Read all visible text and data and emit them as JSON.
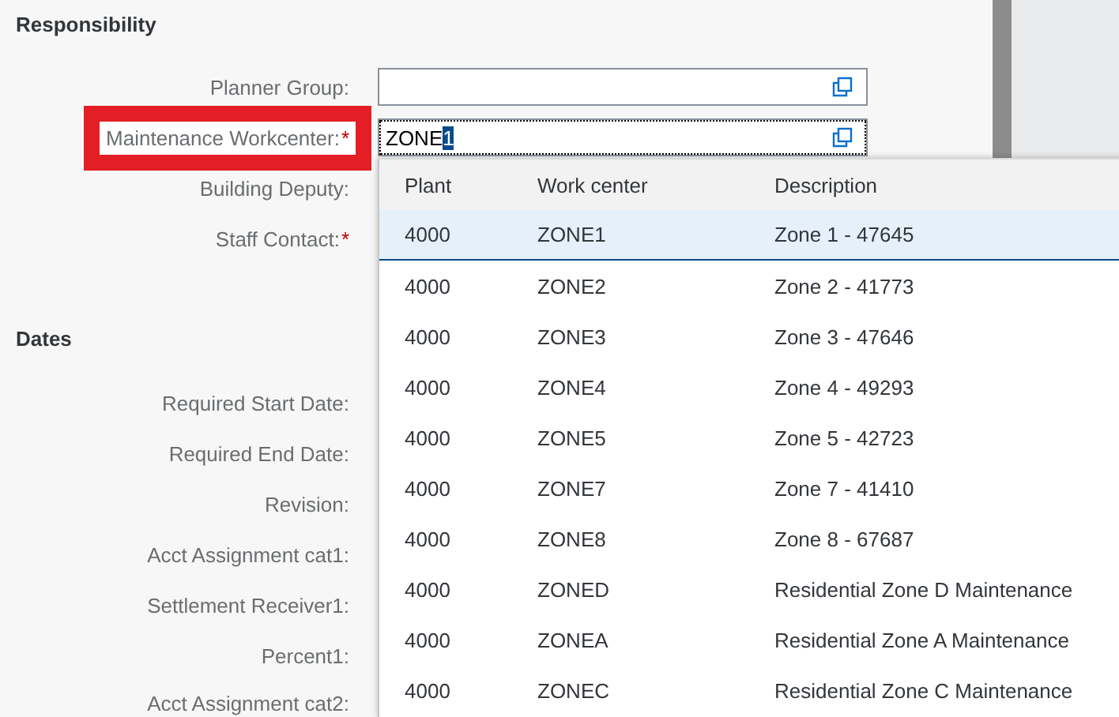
{
  "required_mark": "*",
  "sections": [
    {
      "title": "Responsibility",
      "fields": [
        {
          "label": "Planner Group:",
          "required": false,
          "kind": "valuehelp",
          "highlighted": false
        },
        {
          "label": "Maintenance Workcenter:",
          "required": true,
          "kind": "valuehelp",
          "value": "ZONE",
          "selected_text": "1",
          "highlighted": true
        },
        {
          "label": "Building Deputy:",
          "required": false,
          "kind": "hidden"
        },
        {
          "label": "Staff Contact:",
          "required": true,
          "kind": "hidden"
        }
      ]
    },
    {
      "title": "Dates",
      "fields": [
        {
          "label": "Required Start Date:",
          "required": false,
          "kind": "hidden"
        },
        {
          "label": "Required End Date:",
          "required": false,
          "kind": "hidden"
        },
        {
          "label": "Revision:",
          "required": false,
          "kind": "hidden"
        },
        {
          "label": "Acct Assignment cat1:",
          "required": false,
          "kind": "hidden"
        },
        {
          "label": "Settlement Receiver1:",
          "required": false,
          "kind": "hidden"
        },
        {
          "label": "Percent1:",
          "required": false,
          "kind": "hidden"
        },
        {
          "label": "Acct Assignment cat2:",
          "required": false,
          "kind": "hidden"
        }
      ]
    }
  ],
  "suggestions": {
    "columns": [
      "Plant",
      "Work center",
      "Description"
    ],
    "rows": [
      {
        "cells": [
          "4000",
          "ZONE1",
          "Zone 1 - 47645"
        ],
        "selected": true
      },
      {
        "cells": [
          "4000",
          "ZONE2",
          "Zone 2 - 41773"
        ],
        "selected": false
      },
      {
        "cells": [
          "4000",
          "ZONE3",
          "Zone 3 - 47646"
        ],
        "selected": false
      },
      {
        "cells": [
          "4000",
          "ZONE4",
          "Zone 4 - 49293"
        ],
        "selected": false
      },
      {
        "cells": [
          "4000",
          "ZONE5",
          "Zone 5 - 42723"
        ],
        "selected": false
      },
      {
        "cells": [
          "4000",
          "ZONE7",
          "Zone 7 - 41410"
        ],
        "selected": false
      },
      {
        "cells": [
          "4000",
          "ZONE8",
          "Zone 8 - 67687"
        ],
        "selected": false
      },
      {
        "cells": [
          "4000",
          "ZONED",
          "Residential Zone D Maintenance"
        ],
        "selected": false
      },
      {
        "cells": [
          "4000",
          "ZONEA",
          "Residential Zone A Maintenance"
        ],
        "selected": false
      },
      {
        "cells": [
          "4000",
          "ZONEC",
          "Residential Zone C Maintenance"
        ],
        "selected": false
      }
    ]
  }
}
